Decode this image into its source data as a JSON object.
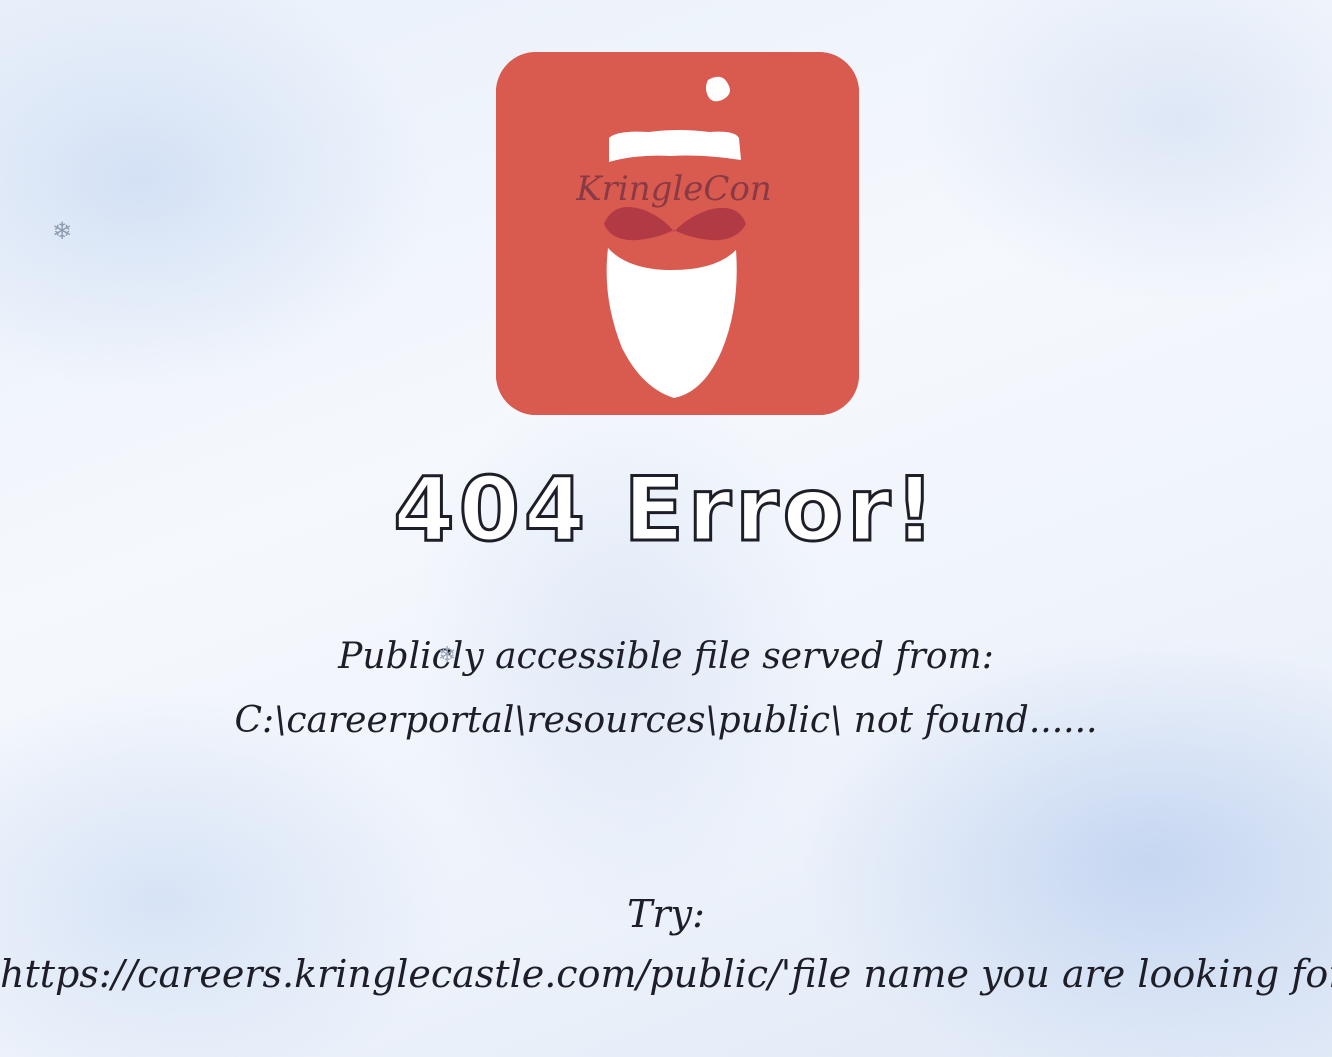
{
  "logo": {
    "icon": "kringlecon-santa-logo-icon",
    "text": "KringleCon",
    "colors": {
      "background": "#d95a4f",
      "hat_trim": "#ffffff",
      "beard": "#ffffff",
      "lettering": "#8a3a45"
    }
  },
  "decorations": {
    "snowflake": "❄"
  },
  "error": {
    "title": "404 Error!",
    "line1": "Publicly accessible file served from:",
    "line2": "C:\\careerportal\\resources\\public\\ not found......"
  },
  "suggestion": {
    "label": "Try:",
    "url": "https://careers.kringlecastle.com/public/'file name you are looking for'"
  }
}
